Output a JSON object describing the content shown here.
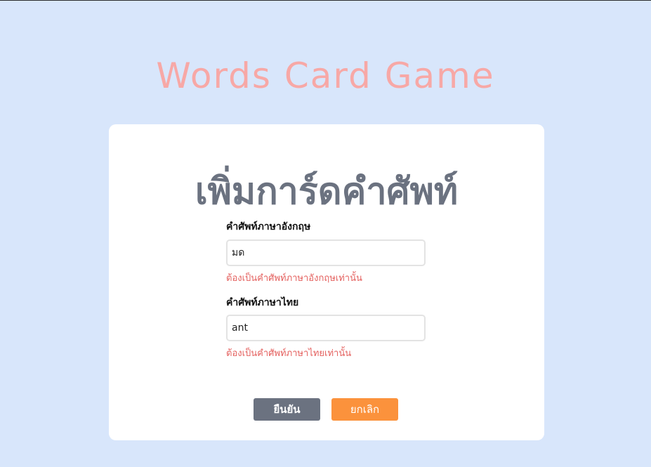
{
  "header": {
    "app_title": "Words Card Game"
  },
  "card": {
    "title": "เพิ่มการ์ดคำศัพท์",
    "english_field": {
      "label": "คำศัพท์ภาษาอังกฤษ",
      "value": "มด",
      "error": "ต้องเป็นคำศัพท์ภาษาอังกฤษเท่านั้น"
    },
    "thai_field": {
      "label": "คำศัพท์ภาษาไทย",
      "value": "ant",
      "error": "ต้องเป็นคำศัพท์ภาษาไทยเท่านั้น"
    },
    "buttons": {
      "confirm_label": "ยืนยัน",
      "cancel_label": "ยกเลิก"
    }
  },
  "colors": {
    "page_background": "#d8e6fb",
    "app_title": "#f7a8a6",
    "card_title": "#6b7280",
    "error": "#e4605e",
    "confirm_button": "#6b7280",
    "cancel_button": "#fb923c"
  }
}
